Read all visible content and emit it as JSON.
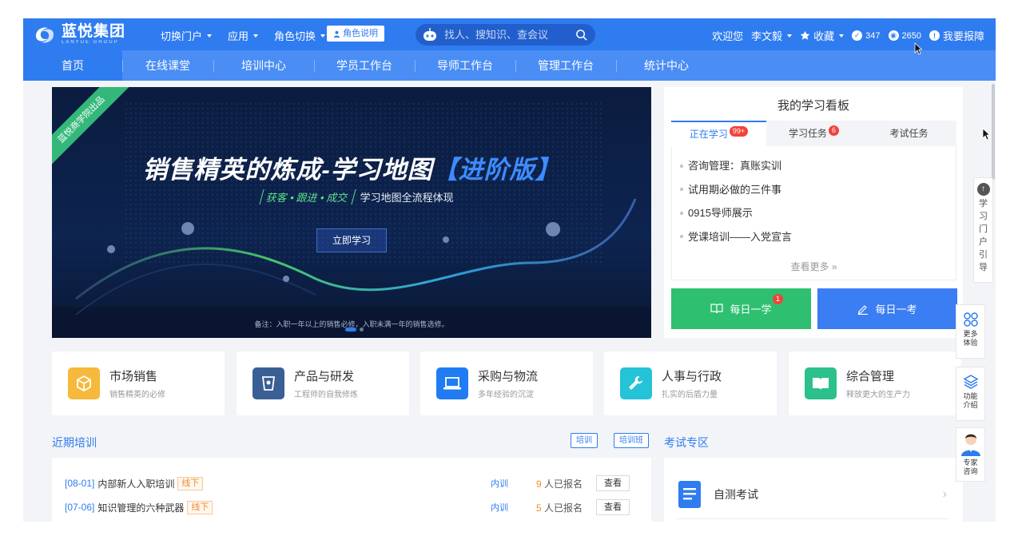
{
  "header": {
    "logo_cn": "蓝悦集团",
    "logo_en": "LANYUE GROUP",
    "menu": [
      {
        "label": "切换门户"
      },
      {
        "label": "应用"
      },
      {
        "label": "角色切换"
      }
    ],
    "role_tag": "角色说明",
    "search_placeholder": "找人、搜知识、查会议",
    "welcome": "欢迎您",
    "user": "李文毅",
    "favorites": "收藏",
    "count_a": "347",
    "count_b": "2650",
    "report": "我要报障"
  },
  "nav": [
    "首页",
    "在线课堂",
    "培训中心",
    "学员工作台",
    "导师工作台",
    "管理工作台",
    "统计中心"
  ],
  "banner": {
    "ribbon": "蓝悦商学院出品",
    "title_main": "销售精英的炼成-学习地图",
    "title_hl": "【进阶版】",
    "tagline": "获客 • 跟进 • 成交",
    "subtitle": "学习地图全流程体现",
    "button": "立即学习",
    "note": "备注：入职一年以上的销售必修，入职未满一年的销售选修。"
  },
  "board": {
    "title": "我的学习看板",
    "tabs": [
      {
        "label": "正在学习",
        "badge": "99+"
      },
      {
        "label": "学习任务",
        "badge": "6"
      },
      {
        "label": "考试任务",
        "badge": ""
      }
    ],
    "items": [
      "咨询管理：真账实训",
      "试用期必做的三件事",
      "0915导师展示",
      "党课培训——入党宣言"
    ],
    "more": "查看更多 »",
    "daily_learn": "每日一学",
    "daily_learn_badge": "1",
    "daily_exam": "每日一考"
  },
  "categories": [
    {
      "name": "市场销售",
      "desc": "销售精英的必修",
      "color": "#f6b93b",
      "icon": "cube-icon"
    },
    {
      "name": "产品与研发",
      "desc": "工程师的自我修炼",
      "color": "#3a5f95",
      "icon": "cup-icon"
    },
    {
      "name": "采购与物流",
      "desc": "多年经验的沉淀",
      "color": "#1f7cf2",
      "icon": "laptop-icon"
    },
    {
      "name": "人事与行政",
      "desc": "扎实的后盾力量",
      "color": "#24c3d8",
      "icon": "wrench-icon"
    },
    {
      "name": "综合管理",
      "desc": "释放更大的生产力",
      "color": "#2cc08a",
      "icon": "book-icon"
    }
  ],
  "trainings": {
    "title": "近期培训",
    "chips": [
      "培训",
      "培训班"
    ],
    "rows": [
      {
        "date": "[08-01]",
        "name": "内部新人入职培训",
        "mode": "线下",
        "type": "内训",
        "count": "9",
        "count_suffix": "人已报名",
        "action": "查看"
      },
      {
        "date": "[07-06]",
        "name": "知识管理的六种武器",
        "mode": "线下",
        "type": "内训",
        "count": "5",
        "count_suffix": "人已报名",
        "action": "查看"
      }
    ]
  },
  "exams": {
    "title": "考试专区",
    "item": "自测考试"
  },
  "side": {
    "guide": "学习门户引导",
    "more": "更多体验",
    "intro": "功能介绍",
    "expert": "专家咨询"
  },
  "colors": {
    "primary": "#2f7cf0",
    "nav": "#4a8df5",
    "green": "#2fbf71",
    "orange": "#f08b2e",
    "badge": "#f0433a"
  }
}
